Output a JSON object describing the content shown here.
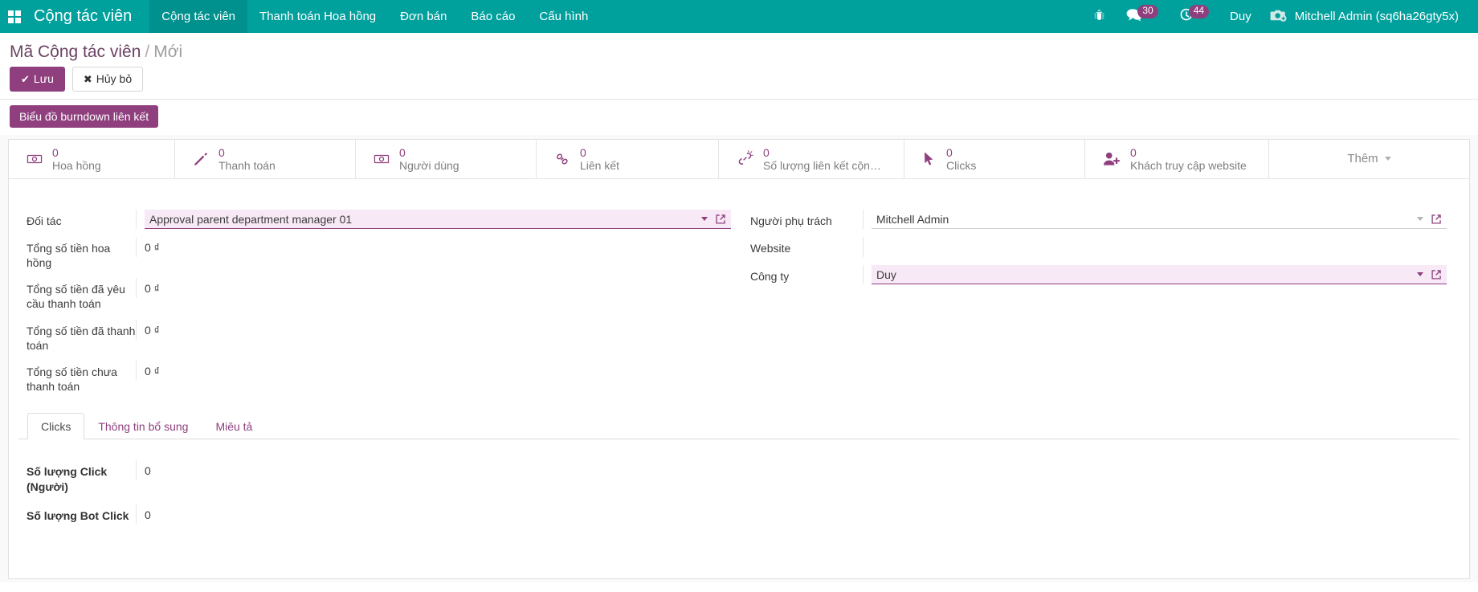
{
  "navbar": {
    "apps_icon": "grid-apps-icon",
    "brand": "Cộng tác viên",
    "menu": [
      {
        "label": "Cộng tác viên",
        "active": true
      },
      {
        "label": "Thanh toán Hoa hồng",
        "active": false
      },
      {
        "label": "Đơn bán",
        "active": false
      },
      {
        "label": "Báo cáo",
        "active": false
      },
      {
        "label": "Cấu hình",
        "active": false
      }
    ],
    "debug_icon": "bug-icon",
    "messages_icon": "chat-icon",
    "messages_count": "30",
    "activities_icon": "clock-icon",
    "activities_count": "44",
    "db_label": "Duy",
    "user_avatar_icon": "camera-avatar-icon",
    "user_name": "Mitchell Admin (sq6ha26gty5x)"
  },
  "control_panel": {
    "breadcrumb_root": "Mã Cộng tác viên",
    "breadcrumb_sep": "/",
    "breadcrumb_current": "Mới",
    "save_label": "Lưu",
    "save_icon": "check-icon",
    "discard_label": "Hủy bỏ",
    "discard_icon": "times-icon",
    "burndown_label": "Biểu đồ burndown liên kết"
  },
  "stat_buttons": [
    {
      "icon": "money-bill-icon",
      "value": "0",
      "label": "Hoa hồng"
    },
    {
      "icon": "pencil-icon",
      "value": "0",
      "label": "Thanh toán"
    },
    {
      "icon": "money-bill-icon",
      "value": "0",
      "label": "Người dùng"
    },
    {
      "icon": "chain-link-icon",
      "value": "0",
      "label": "Liên kết"
    },
    {
      "icon": "chain-broken-icon",
      "value": "0",
      "label": "Số lượng liên kết cộng..."
    },
    {
      "icon": "mouse-pointer-icon",
      "value": "0",
      "label": "Clicks"
    },
    {
      "icon": "user-plus-icon",
      "value": "0",
      "label": "Khách truy cập website"
    }
  ],
  "stat_more_label": "Thêm",
  "form": {
    "left": [
      {
        "label": "Đối tác",
        "type": "m2o",
        "value": "Approval parent department manager 01",
        "required": true
      },
      {
        "label": "Tổng số tiền hoa hồng",
        "type": "money",
        "value": "0 ₫"
      },
      {
        "label": "Tổng số tiền đã yêu cầu thanh toán",
        "type": "money",
        "value": "0 ₫"
      },
      {
        "label": "Tổng số tiền đã thanh toán",
        "type": "money",
        "value": "0 ₫"
      },
      {
        "label": "Tổng số tiền chưa thanh toán",
        "type": "money",
        "value": "0 ₫"
      }
    ],
    "right": [
      {
        "label": "Người phụ trách",
        "type": "m2o",
        "value": "Mitchell Admin",
        "required": false
      },
      {
        "label": "Website",
        "type": "empty",
        "value": ""
      },
      {
        "label": "Công ty",
        "type": "m2o",
        "value": "Duy",
        "required": true
      }
    ]
  },
  "notebook": {
    "tabs": [
      {
        "label": "Clicks",
        "active": true
      },
      {
        "label": "Thông tin bổ sung",
        "active": false
      },
      {
        "label": "Miêu tả",
        "active": false
      }
    ],
    "clicks_fields": [
      {
        "label": "Số lượng Click (Người)",
        "value": "0"
      },
      {
        "label": "Số lượng Bot Click",
        "value": "0"
      }
    ]
  },
  "colors": {
    "navbar": "#00a09d",
    "accent": "#8f3f7e",
    "breadcrumb": "#6b4263",
    "required_bg": "#f7e9f5"
  }
}
